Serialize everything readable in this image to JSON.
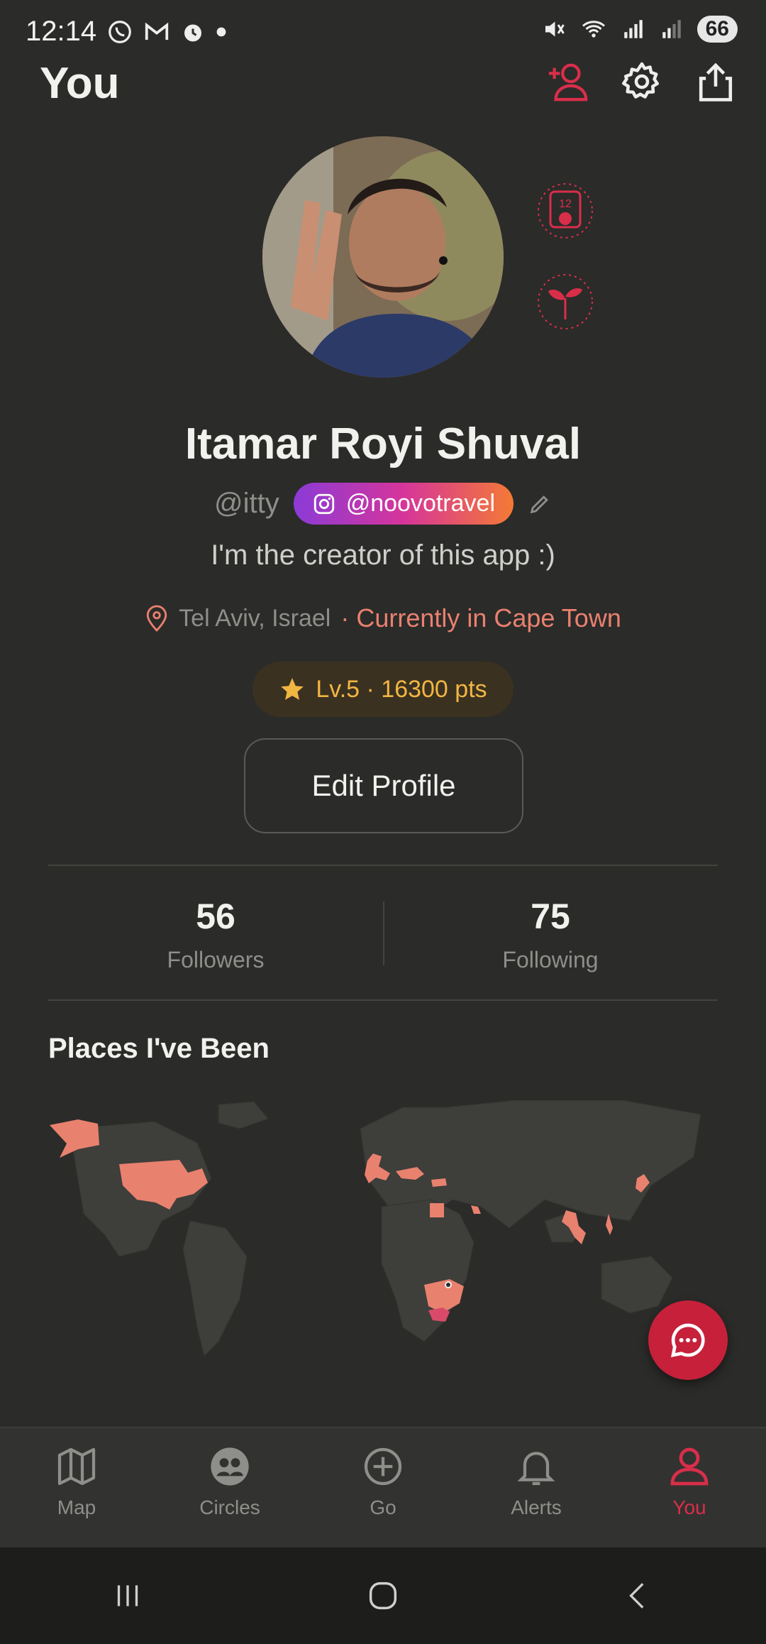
{
  "status_bar": {
    "time": "12:14",
    "battery": "66"
  },
  "header": {
    "title": "You"
  },
  "profile": {
    "name": "Itamar Royi Shuval",
    "handle": "@itty",
    "instagram": "@noovotravel",
    "bio": "I'm the creator of this app :)",
    "hometown": "Tel Aviv, Israel",
    "current_location": "· Currently in Cape Town",
    "level": "Lv.5 · 16300 pts",
    "badge_number": "12"
  },
  "actions": {
    "edit_profile": "Edit Profile"
  },
  "stats": {
    "followers_count": "56",
    "followers_label": "Followers",
    "following_count": "75",
    "following_label": "Following"
  },
  "places": {
    "title": "Places I've Been"
  },
  "tabs": [
    {
      "label": "Map"
    },
    {
      "label": "Circles"
    },
    {
      "label": "Go"
    },
    {
      "label": "Alerts"
    },
    {
      "label": "You"
    }
  ],
  "colors": {
    "accent": "#d92e4a",
    "visited": "#e9816f",
    "level": "#f1b642"
  }
}
